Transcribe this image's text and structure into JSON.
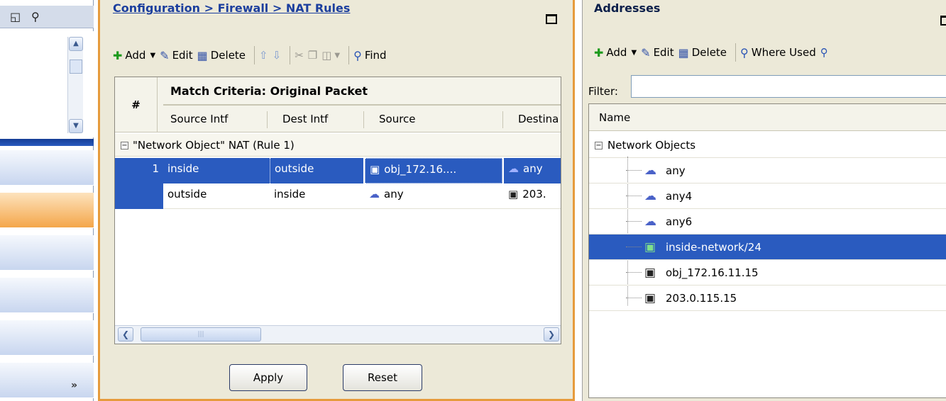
{
  "nat_panel": {
    "title": "Configuration > Firewall > NAT Rules",
    "toolbar": {
      "add": "Add",
      "edit": "Edit",
      "delete": "Delete",
      "find": "Find"
    },
    "grid": {
      "hash_header": "#",
      "group_header": "Match Criteria: Original Packet",
      "columns": [
        "Source Intf",
        "Dest Intf",
        "Source",
        "Destina"
      ],
      "group_row": "\"Network Object\" NAT (Rule 1)",
      "rows": [
        {
          "num": "1",
          "source_intf": "inside",
          "dest_intf": "outside",
          "source": "obj_172.16....",
          "destination": "any"
        },
        {
          "num": "",
          "source_intf": "outside",
          "dest_intf": "inside",
          "source": "any",
          "destination": "203."
        }
      ]
    },
    "buttons": {
      "apply": "Apply",
      "reset": "Reset"
    }
  },
  "addresses_panel": {
    "title": "Addresses",
    "toolbar": {
      "add": "Add",
      "edit": "Edit",
      "delete": "Delete",
      "where_used": "Where Used"
    },
    "filter_label": "Filter:",
    "filter_value": "",
    "column_header": "Name",
    "root": "Network Objects",
    "items": [
      {
        "label": "any",
        "icon": "network-cloud-icon"
      },
      {
        "label": "any4",
        "icon": "network-cloud-icon"
      },
      {
        "label": "any6",
        "icon": "network-cloud-icon"
      },
      {
        "label": "inside-network/24",
        "icon": "network-object-icon"
      },
      {
        "label": "obj_172.16.11.15",
        "icon": "host-icon"
      },
      {
        "label": "203.0.115.15",
        "icon": "host-icon"
      }
    ]
  },
  "colors": {
    "selection": "#2a5bbf",
    "panel_border_active": "#e69b3c",
    "title_link": "#1c3f9e",
    "panel_bg": "#ece9d8"
  }
}
